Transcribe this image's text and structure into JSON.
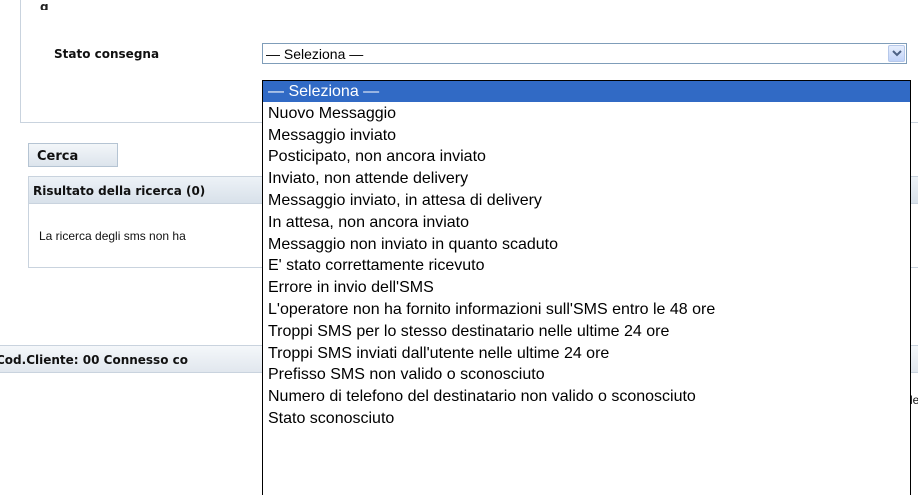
{
  "top_cut_text": "g",
  "filter": {
    "label": "Stato consegna",
    "selected_value": "— Seleziona —",
    "options": [
      "— Seleziona —",
      "Nuovo Messaggio",
      "Messaggio inviato",
      "Posticipato, non ancora inviato",
      "Inviato, non attende delivery",
      "Messaggio inviato, in attesa di delivery",
      "In attesa, non ancora inviato",
      "Messaggio non inviato in quanto scaduto",
      "E' stato correttamente ricevuto",
      "Errore in invio dell'SMS",
      "L'operatore non ha fornito informazioni sull'SMS entro le 48 ore",
      "Troppi SMS per lo stesso destinatario nelle ultime 24 ore",
      "Troppi SMS inviati dall'utente nelle ultime 24 ore",
      "Prefisso SMS non valido o sconosciuto",
      "Numero di telefono del destinatario non valido o sconosciuto",
      "Stato sconosciuto"
    ],
    "highlighted_index": 0
  },
  "search_button": {
    "label": "Cerca"
  },
  "results": {
    "title": "Risultato della ricerca (0)",
    "message": "La ricerca degli sms non ha"
  },
  "footer": {
    "text": "Cod.Cliente: 00 Connesso co"
  },
  "right_cut_text": "le",
  "colors": {
    "highlight": "#316ac5",
    "border": "#7f9db9"
  },
  "icons": {
    "dropdown_arrow": "chevron-down-icon"
  }
}
